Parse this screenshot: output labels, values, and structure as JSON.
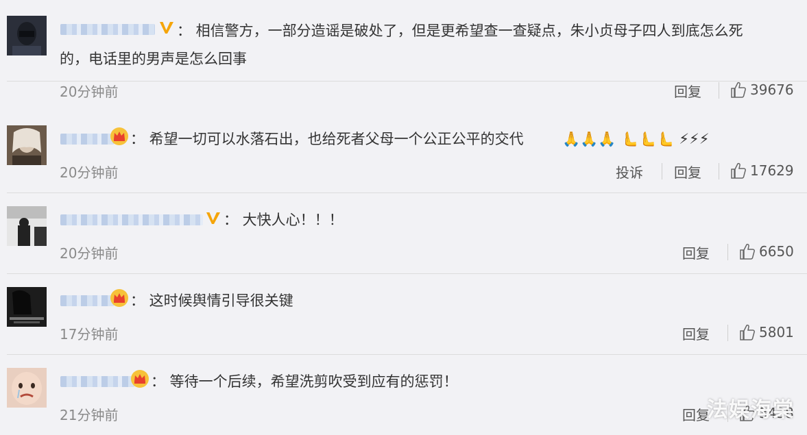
{
  "comments": [
    {
      "text": "：   相信警方，一部分造谣是破处了，但是更希望查一查疑点，朱小贞母子四人到底怎么死",
      "text2": "的，电话里的男声是怎么回事",
      "time": "20分钟前",
      "reply": "回复",
      "likes": "39676",
      "badge": "V"
    },
    {
      "text": "：   希望一切可以水落石出，也给死者父母一个公正公平的交代",
      "emojis": "🙏🙏🙏 🫷🫷🫷 ⚡⚡⚡",
      "time": "20分钟前",
      "report": "投诉",
      "reply": "回复",
      "likes": "17629",
      "badge": "crown"
    },
    {
      "text": "：   大快人心！！！",
      "time": "20分钟前",
      "reply": "回复",
      "likes": "6650",
      "badge": "V"
    },
    {
      "text": "：   这时候舆情引导很关键",
      "time": "17分钟前",
      "reply": "回复",
      "likes": "5801",
      "badge": "crown"
    },
    {
      "text": "：   等待一个后续，希望洗剪吹受到应有的惩罚！",
      "time": "21分钟前",
      "reply": "回复",
      "likes": "3438",
      "badge": "crown"
    }
  ],
  "watermark": "法娱海棠"
}
